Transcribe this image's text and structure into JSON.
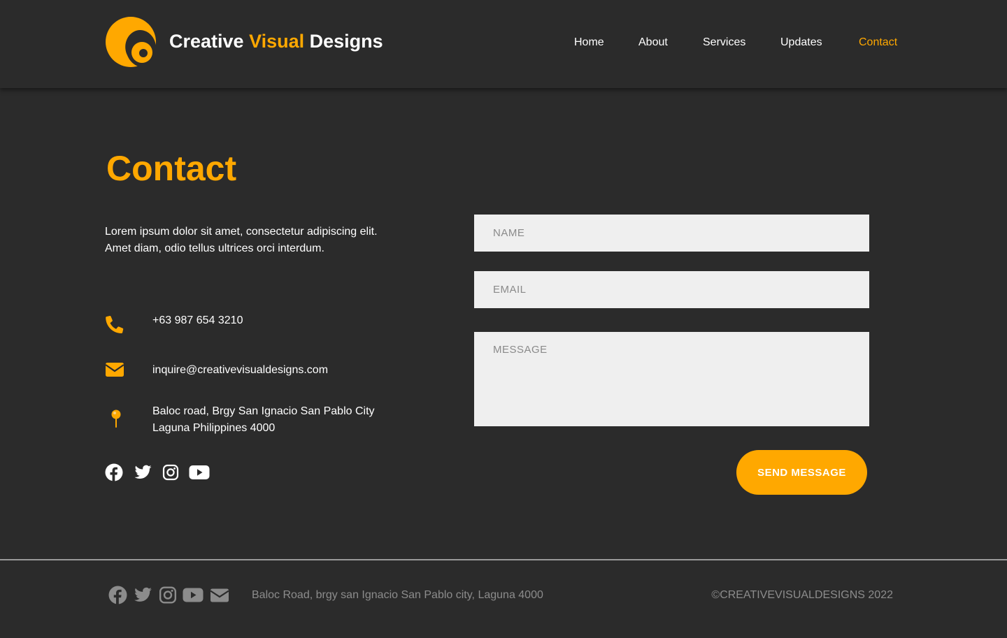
{
  "colors": {
    "accent": "#ffa800",
    "background": "#2b2b2b",
    "field": "#efefef",
    "footer_text": "#8c8c8c"
  },
  "brand": {
    "part1": "Creative ",
    "part2": "Visual",
    "part3": " Designs",
    "logo_icon": "c-logo-icon"
  },
  "nav": {
    "items": [
      {
        "label": "Home"
      },
      {
        "label": "About"
      },
      {
        "label": "Services"
      },
      {
        "label": "Updates"
      },
      {
        "label": "Contact",
        "active": true
      }
    ]
  },
  "contact": {
    "title": "Contact",
    "intro_line1": "Lorem ipsum dolor sit amet, consectetur adipiscing elit.",
    "intro_line2": "Amet diam, odio tellus ultrices orci interdum.",
    "phone": "+63 987 654 3210",
    "email": "inquire@creativevisualdesigns.com",
    "address_line1": "Baloc road, Brgy San Ignacio San Pablo City",
    "address_line2": "Laguna Philippines 4000",
    "socials": [
      "facebook-icon",
      "twitter-icon",
      "instagram-icon",
      "youtube-icon"
    ]
  },
  "form": {
    "name_placeholder": "NAME",
    "email_placeholder": "EMAIL",
    "message_placeholder": "MESSAGE",
    "submit_label": "SEND MESSAGE"
  },
  "footer": {
    "icons": [
      "facebook-icon",
      "twitter-icon",
      "instagram-icon",
      "youtube-icon",
      "envelope-icon"
    ],
    "address": "Baloc Road, brgy san Ignacio San Pablo city, Laguna 4000",
    "copyright": "©CREATIVEVISUALDESIGNS 2022"
  }
}
